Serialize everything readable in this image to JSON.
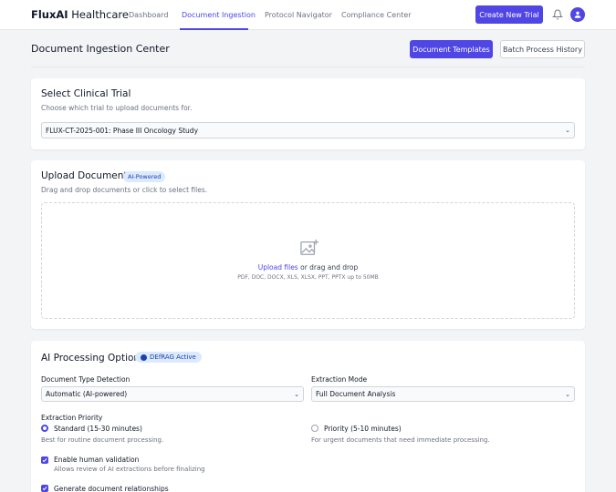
{
  "header": {
    "brand_bold": "FluxAI",
    "brand_light": " Healthcare",
    "nav": [
      "Dashboard",
      "Document Ingestion",
      "Protocol Navigator",
      "Compliance Center"
    ],
    "create_button": "Create New Trial",
    "icons": {
      "notifications": "bell-icon",
      "user": "user-avatar-icon"
    },
    "accent_color": "#4f46e5"
  },
  "page": {
    "title": "Document Ingestion Center",
    "templates_button": "Document Templates",
    "history_button": "Batch Process History"
  },
  "trial_card": {
    "title": "Select Clinical Trial",
    "subtitle": "Choose which trial to upload documents for.",
    "selected": "FLUX-CT-2025-001: Phase III Oncology Study"
  },
  "upload_card": {
    "title": "Upload Documents",
    "badge": "AI-Powered",
    "subtitle": "Drag and drop documents or click to select files.",
    "link": "Upload files",
    "text": "or drag and drop",
    "hint": "PDF, DOC, DOCX, XLS, XLSX, PPT, PPTX up to 50MB",
    "icon": "image-upload-icon"
  },
  "processing_card": {
    "title": "AI Processing Options",
    "badge": "DEfRAG Active",
    "doc_type_label": "Document Type Detection",
    "doc_type_value": "Automatic (AI-powered)",
    "extraction_mode_label": "Extraction Mode",
    "extraction_mode_value": "Full Document Analysis",
    "priority_label": "Extraction Priority",
    "priority_options": [
      {
        "label": "Standard (15-30 minutes)",
        "hint": "Best for routine document processing.",
        "selected": true
      },
      {
        "label": "Priority (5-10 minutes)",
        "hint": "For urgent documents that need immediate processing.",
        "selected": false
      }
    ],
    "human_validation_label": "Enable human validation",
    "human_validation_hint": "Allows review of AI extractions before finalizing",
    "human_validation_checked": true,
    "relationships_label": "Generate document relationships",
    "relationships_checked": true
  }
}
